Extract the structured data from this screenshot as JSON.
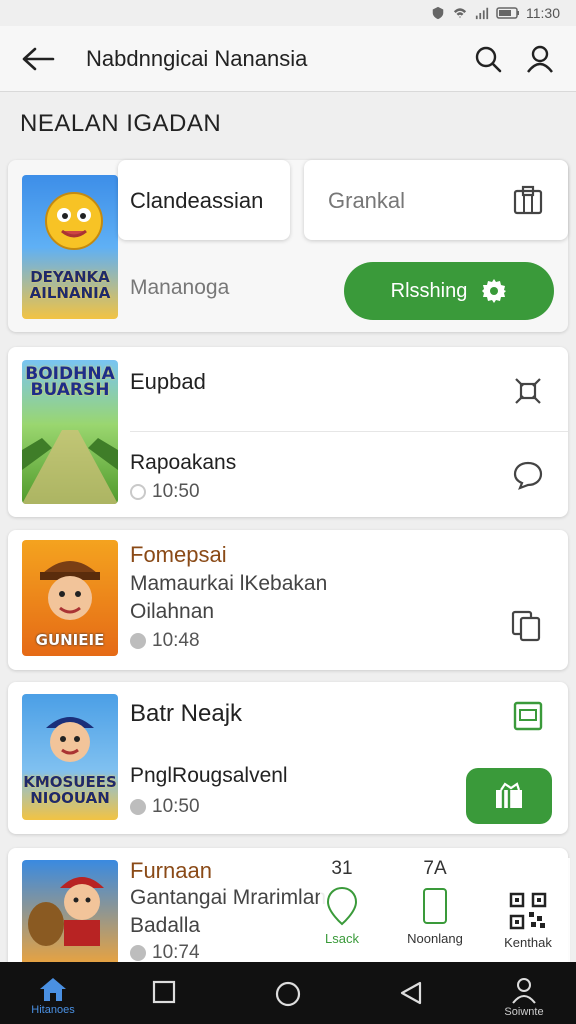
{
  "status": {
    "time": "11:30"
  },
  "header": {
    "title": "Nabdnngicai Nanansia"
  },
  "section": {
    "title": "NEALAN IGADAN"
  },
  "card1": {
    "thumb_caption": "DEYANKA AILNANIA",
    "title": "Clandeassian",
    "panel_label": "Grankal",
    "subtitle": "Mananoga",
    "action_label": "Rlsshing"
  },
  "card2": {
    "thumb_caption": "BOIDHNA BUARSH",
    "title": "Eupbad",
    "subtitle": "Rapoakans",
    "time": "10:50"
  },
  "card3": {
    "thumb_caption": "GUNIEIE",
    "title": "Fomepsai",
    "line1": "Mamaurkai lKebakan",
    "line2": "Oilahnan",
    "time": "10:48"
  },
  "card4": {
    "thumb_caption": "KMOSUEES NIOOUAN",
    "title": "Batr Neajk",
    "subtitle": "PnglRougsalvenl",
    "time": "10:50"
  },
  "card5": {
    "title": "Furnaan",
    "line1": "Gantangai Mrarimlan",
    "line2": "Badalla",
    "time": "10:74"
  },
  "float_nav": {
    "count1": "31",
    "count2": "7A",
    "item1": "Lsack",
    "item2": "Noonlang",
    "item3": "Kenthak"
  },
  "sys_nav": {
    "home_label": "Hitanoes",
    "profile_label": "Soiwnte"
  },
  "colors": {
    "accent_green": "#3a9a3a",
    "title_brown": "#8a4a17"
  }
}
